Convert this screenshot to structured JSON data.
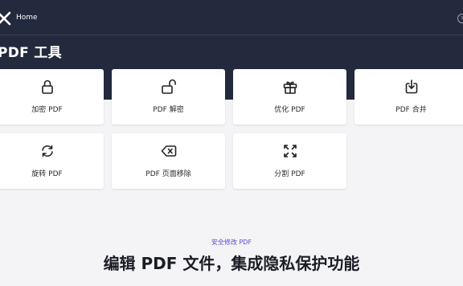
{
  "header": {
    "home_label": "Home",
    "page_title": "PDF 工具"
  },
  "tools": [
    {
      "label": "加密 PDF",
      "icon": "lock-icon"
    },
    {
      "label": "PDF 解密",
      "icon": "unlock-icon"
    },
    {
      "label": "优化 PDF",
      "icon": "gift-icon"
    },
    {
      "label": "PDF 合并",
      "icon": "merge-icon"
    },
    {
      "label": "旋转 PDF",
      "icon": "rotate-icon"
    },
    {
      "label": "PDF 页面移除",
      "icon": "backspace-icon"
    },
    {
      "label": "分割 PDF",
      "icon": "split-icon"
    }
  ],
  "feature": {
    "eyebrow": "安全修改 PDF",
    "headline": "编辑 PDF 文件，集成隐私保护功能"
  },
  "colors": {
    "hero_bg": "#232a3e",
    "page_bg": "#f4f4f6",
    "accent": "#5b47d6"
  }
}
